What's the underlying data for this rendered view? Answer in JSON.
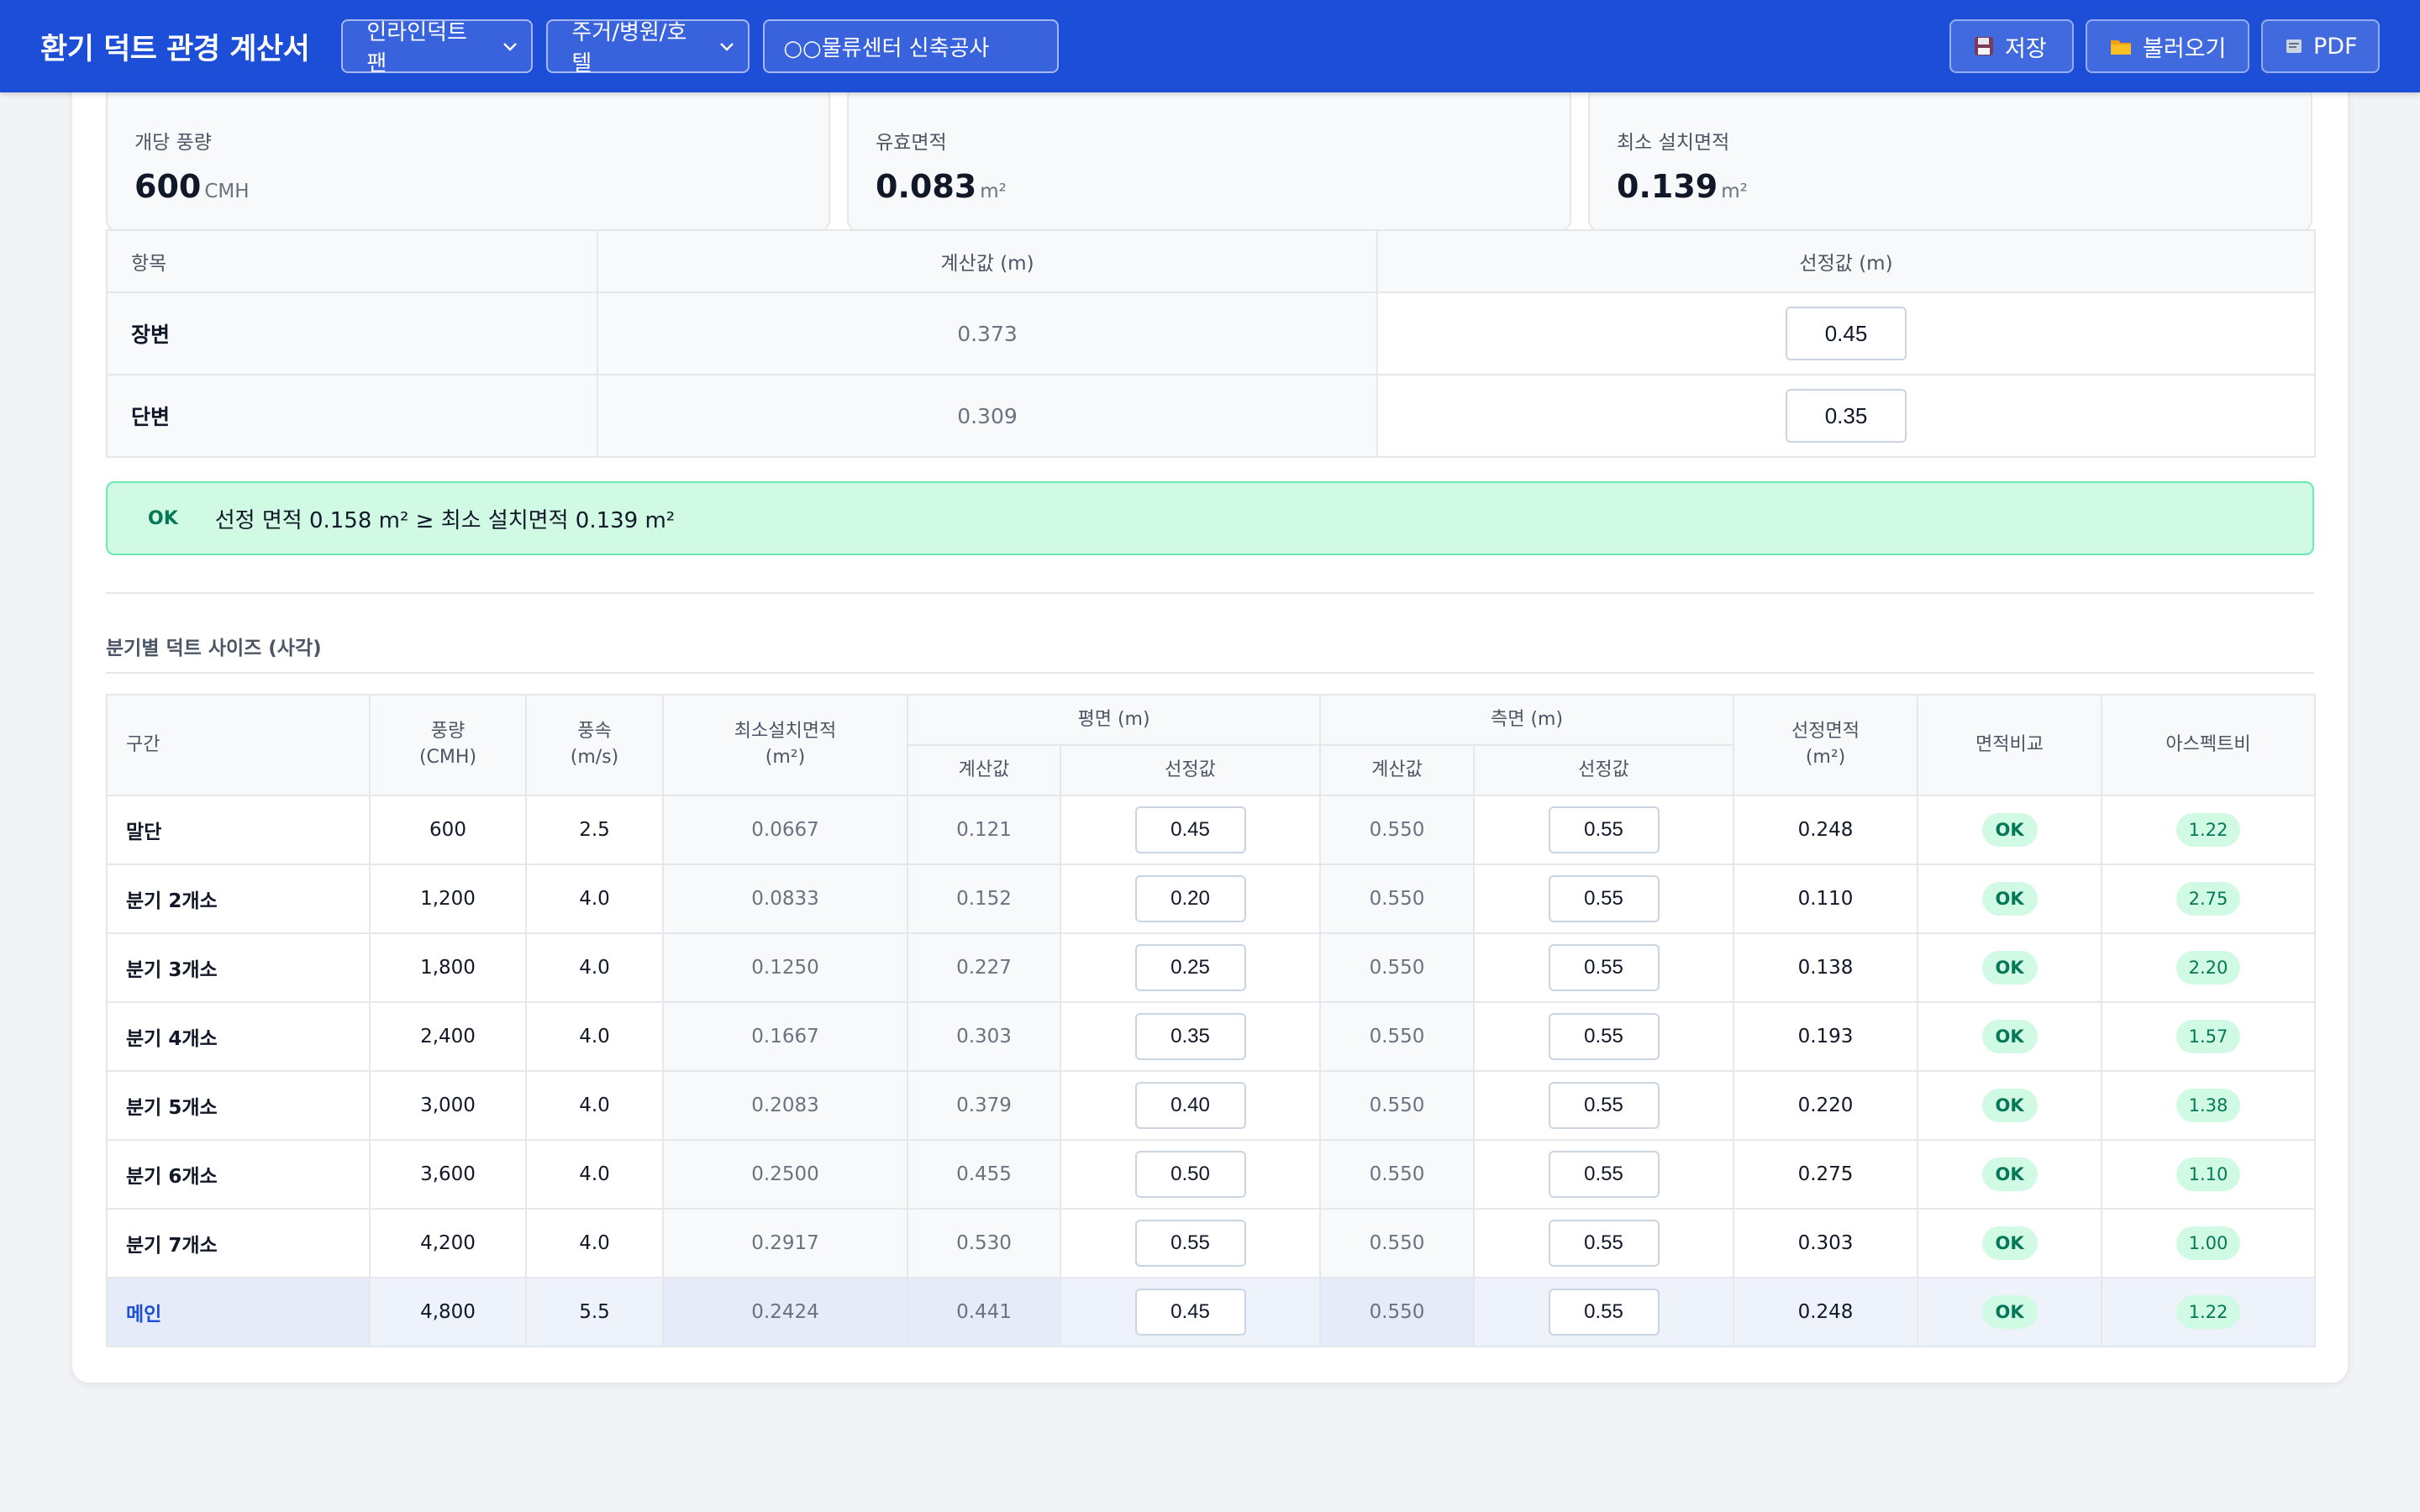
{
  "header": {
    "title": "환기 덕트 관경 계산서",
    "equipment_select": "인라인덕트팬",
    "use_select": "주거/병원/호텔",
    "project_name": "○○물류센터 신축공사",
    "buttons": {
      "save": "저장",
      "load": "불러오기",
      "pdf": "PDF"
    }
  },
  "summary": [
    {
      "label": "개당 풍량",
      "value": "600",
      "unit": "CMH"
    },
    {
      "label": "유효면적",
      "value": "0.083",
      "unit": "m²"
    },
    {
      "label": "최소 설치면적",
      "value": "0.139",
      "unit": "m²"
    }
  ],
  "dimension_table": {
    "headers": {
      "item": "항목",
      "calc": "계산값 (m)",
      "selected": "선정값 (m)"
    },
    "rows": [
      {
        "name": "장변",
        "calc": "0.373",
        "selected": "0.45"
      },
      {
        "name": "단변",
        "calc": "0.309",
        "selected": "0.35"
      }
    ]
  },
  "ok_banner": {
    "tag": "OK",
    "text": "선정 면적 0.158 m² ≥ 최소 설치면적 0.139 m²"
  },
  "branch_section": {
    "title": "분기별 덕트 사이즈 (사각)",
    "headers": {
      "section": "구간",
      "flow": "풍량",
      "flow_unit": "(CMH)",
      "velocity": "풍속",
      "velocity_unit": "(m/s)",
      "min_area": "최소설치면적",
      "min_area_unit": "(m²)",
      "plan": "평면 (m)",
      "side": "측면 (m)",
      "calc": "계산값",
      "selected": "선정값",
      "sel_area": "선정면적",
      "sel_area_unit": "(m²)",
      "compare": "면적비교",
      "aspect": "아스펙트비"
    },
    "rows": [
      {
        "name": "말단",
        "flow": "600",
        "velocity": "2.5",
        "min_area": "0.0667",
        "plan_calc": "0.121",
        "plan_sel": "0.45",
        "side_calc": "0.550",
        "side_sel": "0.55",
        "sel_area": "0.248",
        "compare": "OK",
        "aspect": "1.22"
      },
      {
        "name": "분기 2개소",
        "flow": "1,200",
        "velocity": "4.0",
        "min_area": "0.0833",
        "plan_calc": "0.152",
        "plan_sel": "0.20",
        "side_calc": "0.550",
        "side_sel": "0.55",
        "sel_area": "0.110",
        "compare": "OK",
        "aspect": "2.75"
      },
      {
        "name": "분기 3개소",
        "flow": "1,800",
        "velocity": "4.0",
        "min_area": "0.1250",
        "plan_calc": "0.227",
        "plan_sel": "0.25",
        "side_calc": "0.550",
        "side_sel": "0.55",
        "sel_area": "0.138",
        "compare": "OK",
        "aspect": "2.20"
      },
      {
        "name": "분기 4개소",
        "flow": "2,400",
        "velocity": "4.0",
        "min_area": "0.1667",
        "plan_calc": "0.303",
        "plan_sel": "0.35",
        "side_calc": "0.550",
        "side_sel": "0.55",
        "sel_area": "0.193",
        "compare": "OK",
        "aspect": "1.57"
      },
      {
        "name": "분기 5개소",
        "flow": "3,000",
        "velocity": "4.0",
        "min_area": "0.2083",
        "plan_calc": "0.379",
        "plan_sel": "0.40",
        "side_calc": "0.550",
        "side_sel": "0.55",
        "sel_area": "0.220",
        "compare": "OK",
        "aspect": "1.38"
      },
      {
        "name": "분기 6개소",
        "flow": "3,600",
        "velocity": "4.0",
        "min_area": "0.2500",
        "plan_calc": "0.455",
        "plan_sel": "0.50",
        "side_calc": "0.550",
        "side_sel": "0.55",
        "sel_area": "0.275",
        "compare": "OK",
        "aspect": "1.10"
      },
      {
        "name": "분기 7개소",
        "flow": "4,200",
        "velocity": "4.0",
        "min_area": "0.2917",
        "plan_calc": "0.530",
        "plan_sel": "0.55",
        "side_calc": "0.550",
        "side_sel": "0.55",
        "sel_area": "0.303",
        "compare": "OK",
        "aspect": "1.00"
      },
      {
        "name": "메인",
        "flow": "4,800",
        "velocity": "5.5",
        "min_area": "0.2424",
        "plan_calc": "0.441",
        "plan_sel": "0.45",
        "side_calc": "0.550",
        "side_sel": "0.55",
        "sel_area": "0.248",
        "compare": "OK",
        "aspect": "1.22"
      }
    ]
  },
  "colors": {
    "header_bg": "#1d4ed8",
    "ok_bg": "#d1fae5",
    "ok_text": "#047857",
    "main_row_text": "#1d4ed8"
  },
  "icons": {
    "save": "floppy-disk-icon",
    "load": "folder-icon",
    "pdf": "document-icon",
    "select": "chevron-down-icon"
  }
}
